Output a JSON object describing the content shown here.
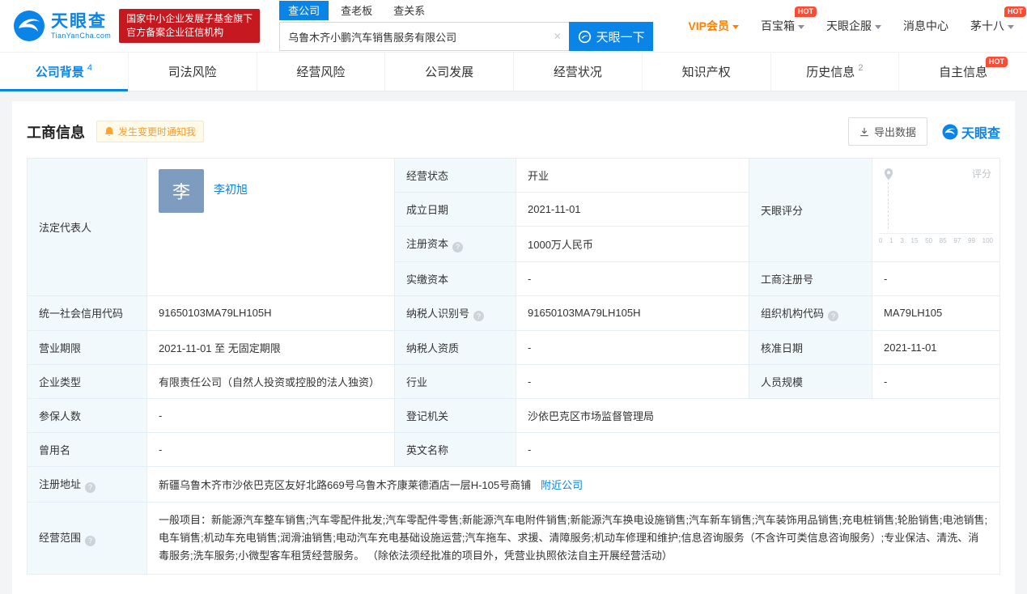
{
  "header": {
    "logo": {
      "brand": "天眼查",
      "domain": "TianYanCha.com"
    },
    "cert_badge": {
      "line1": "国家中小企业发展子基金旗下",
      "line2": "官方备案企业征信机构"
    },
    "search": {
      "tabs": [
        {
          "label": "查公司"
        },
        {
          "label": "查老板"
        },
        {
          "label": "查关系"
        }
      ],
      "value": "乌鲁木齐小鹏汽车销售服务有限公司",
      "clear_icon": "×",
      "button_label": "天眼一下"
    },
    "nav": {
      "vip": "VIP会员",
      "toolbox": "百宝箱",
      "enterprise_service": "天眼企服",
      "message_center": "消息中心",
      "username": "茅十八",
      "hot_badge": "HOT"
    }
  },
  "nav_tabs": [
    {
      "label": "公司背景",
      "count": "4"
    },
    {
      "label": "司法风险"
    },
    {
      "label": "经营风险"
    },
    {
      "label": "公司发展"
    },
    {
      "label": "经营状况"
    },
    {
      "label": "知识产权"
    },
    {
      "label": "历史信息",
      "count": "2"
    },
    {
      "label": "自主信息",
      "hot": "HOT"
    }
  ],
  "section": {
    "title": "工商信息",
    "notify_button": "发生变更时通知我",
    "export_button": "导出数据",
    "brand": "天眼查"
  },
  "icons": {
    "help": "?"
  },
  "fields": {
    "legal_rep": {
      "label": "法定代表人",
      "avatar": "李",
      "name": "李初旭"
    },
    "business_status": {
      "label": "经营状态",
      "value": "开业"
    },
    "establish_date": {
      "label": "成立日期",
      "value": "2021-11-01"
    },
    "registered_capital": {
      "label": "注册资本",
      "value": "1000万人民币"
    },
    "paid_in_capital": {
      "label": "实缴资本",
      "value": "-"
    },
    "tianyan_score": {
      "label": "天眼评分",
      "chart_title": "评分",
      "axis": [
        "0",
        "1",
        "3",
        "15",
        "50",
        "85",
        "97",
        "99",
        "100"
      ]
    },
    "registration_no": {
      "label": "工商注册号",
      "value": "-"
    },
    "credit_code": {
      "label": "统一社会信用代码",
      "value": "91650103MA79LH105H"
    },
    "taxpayer_id": {
      "label": "纳税人识别号",
      "value": "91650103MA79LH105H"
    },
    "org_code": {
      "label": "组织机构代码",
      "value": "MA79LH105"
    },
    "business_term": {
      "label": "营业期限",
      "value": "2021-11-01 至 无固定期限"
    },
    "taxpayer_quality": {
      "label": "纳税人资质",
      "value": "-"
    },
    "approved_date": {
      "label": "核准日期",
      "value": "2021-11-01"
    },
    "company_type": {
      "label": "企业类型",
      "value": "有限责任公司（自然人投资或控股的法人独资）"
    },
    "industry": {
      "label": "行业",
      "value": "-"
    },
    "staff_size": {
      "label": "人员规模",
      "value": "-"
    },
    "insured_staff": {
      "label": "参保人数",
      "value": "-"
    },
    "registration_authority": {
      "label": "登记机关",
      "value": "沙依巴克区市场监督管理局"
    },
    "former_name": {
      "label": "曾用名",
      "value": "-"
    },
    "english_name": {
      "label": "英文名称",
      "value": "-"
    },
    "registered_address": {
      "label": "注册地址",
      "value": "新疆乌鲁木齐市沙依巴克区友好北路669号乌鲁木齐康莱德酒店一层H-105号商铺",
      "nearby_link": "附近公司"
    },
    "business_scope": {
      "label": "经营范围",
      "value": "一般项目：新能源汽车整车销售;汽车零配件批发;汽车零配件零售;新能源汽车电附件销售;新能源汽车换电设施销售;汽车新车销售;汽车装饰用品销售;充电桩销售;轮胎销售;电池销售;电车销售;机动车充电销售;润滑油销售;电动汽车充电基础设施运营;汽车拖车、求援、清障服务;机动车修理和维护;信息咨询服务（不含许可类信息咨询服务）;专业保洁、清洗、消毒服务;洗车服务;小微型客车租赁经营服务。 （除依法须经批准的项目外，凭营业执照依法自主开展经营活动）"
    }
  },
  "colors": {
    "brand_blue": "#0b84e8",
    "cert_badge_red": "#c5191f",
    "hot_red": "#ff4b33",
    "vip_orange": "#ff8000",
    "notify_orange": "#ff9b2c",
    "label_cell_bg": "#f2f9fc",
    "table_border": "#e4eef6"
  }
}
